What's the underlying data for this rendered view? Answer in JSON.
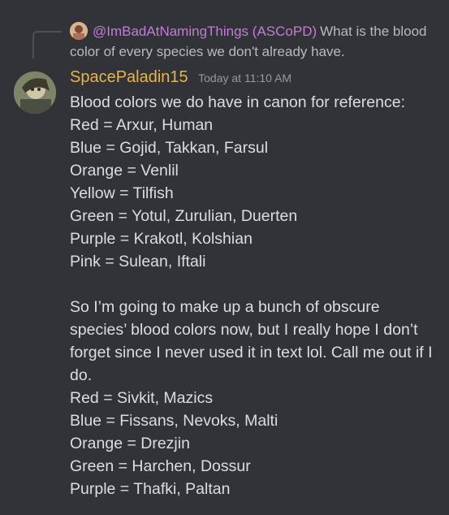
{
  "reply": {
    "mention": "@ImBadAtNamingThings (ASCoPD)",
    "text": "What is the blood color of every species we don't already have."
  },
  "message": {
    "username": "SpacePaladin15",
    "timestamp": "Today at 11:10 AM",
    "lines": [
      "Blood colors we do have in canon for reference:",
      "Red = Arxur, Human",
      "Blue = Gojid, Takkan, Farsul",
      "Orange = Venlil",
      "Yellow = Tilfish",
      "Green = Yotul, Zurulian, Duerten",
      "Purple = Krakotl, Kolshian",
      "Pink = Sulean, Iftali",
      "",
      "So I’m going to make up a bunch of obscure species’ blood colors now, but I really hope I don’t forget since I never used it in text lol. Call me out if I do.",
      "Red = Sivkit, Mazics",
      "Blue = Fissans, Nevoks, Malti",
      "Orange = Drezjin",
      "Green = Harchen, Dossur",
      "Purple = Thafki, Paltan"
    ]
  },
  "colors": {
    "background": "#313338",
    "username": "#e6b54a",
    "mention": "#c47bd8",
    "text": "#dbdee1",
    "muted": "#949ba4"
  },
  "icons": {
    "reply_avatar": "user-avatar-small",
    "author_avatar": "user-avatar"
  }
}
